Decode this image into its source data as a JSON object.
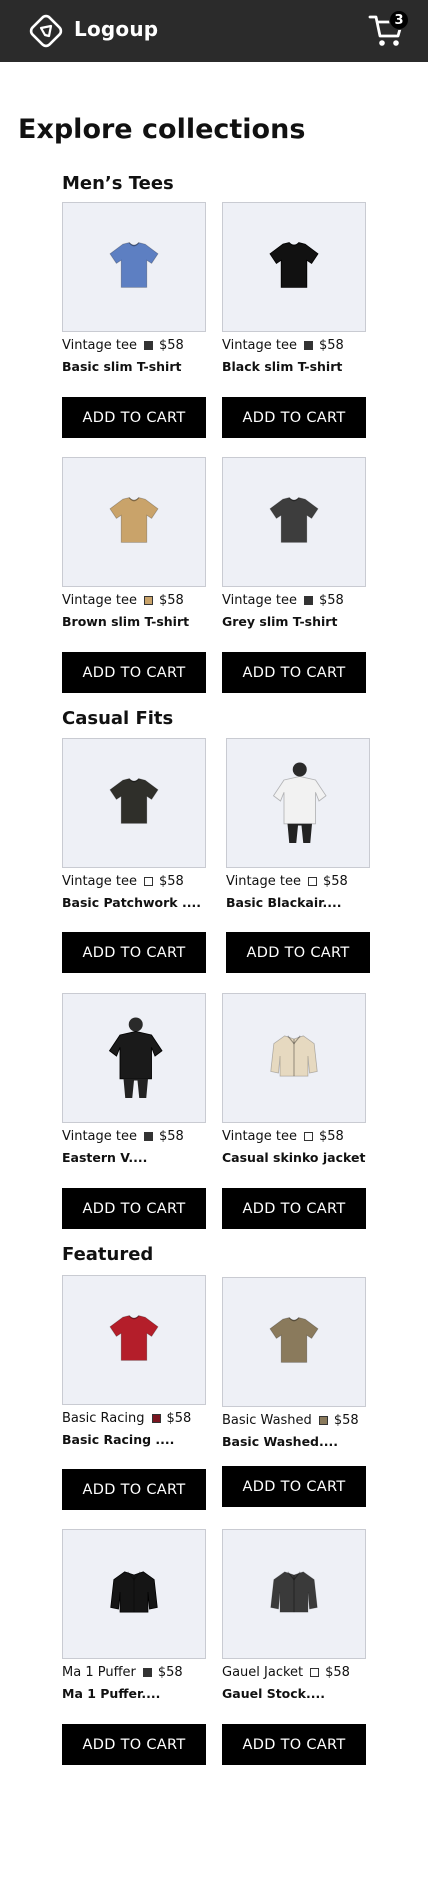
{
  "header": {
    "logo_text": "Logoup",
    "cart_count": "3",
    "colors": {
      "bar": "#2b2b2b",
      "text": "#ffffff"
    }
  },
  "page_title": "Explore collections",
  "add_label": "ADD TO CART",
  "sections": [
    {
      "title": "Men’s Tees",
      "products": [
        {
          "meta": "Vintage tee",
          "price": "$58",
          "name": "Basic slim T-shirt",
          "swatch": "#333333",
          "shirt": "#5d7fc2",
          "icon": "blue-tshirt-icon"
        },
        {
          "meta": "Vintage tee",
          "price": "$58",
          "name": "Black slim T-shirt",
          "swatch": "#333333",
          "shirt": "#111111",
          "icon": "black-tshirt-icon"
        },
        {
          "meta": "Vintage tee",
          "price": "$58",
          "name": "Brown slim T-shirt",
          "swatch": "#c9a36a",
          "shirt": "#c9a36a",
          "icon": "brown-tshirt-icon"
        },
        {
          "meta": "Vintage tee",
          "price": "$58",
          "name": "Grey slim T-shirt",
          "swatch": "#333333",
          "shirt": "#3d3d3d",
          "icon": "grey-tshirt-icon"
        }
      ]
    },
    {
      "title": "Casual Fits",
      "products": [
        {
          "meta": "Vintage tee",
          "price": "$58",
          "name": "Basic Patchwork ....",
          "swatch": "#ffffff",
          "shirt": "#2f2f2a",
          "icon": "patchwork-tshirt-icon"
        },
        {
          "meta": "Vintage tee",
          "price": "$58",
          "name": "Basic Blackair....",
          "swatch": "#ffffff",
          "shirt": "#f2f2f2",
          "icon": "white-tshirt-model-icon"
        },
        {
          "meta": "Vintage tee",
          "price": "$58",
          "name": "Eastern V....",
          "swatch": "#333333",
          "shirt": "#1a1a1a",
          "icon": "jersey-model-icon"
        },
        {
          "meta": "Vintage tee",
          "price": "$58",
          "name": "Casual skinko jacket",
          "swatch": "#ffffff",
          "shirt": "#e6d9c0",
          "icon": "jacket-icon"
        }
      ]
    },
    {
      "title": "Featured",
      "products": [
        {
          "meta": "Basic Racing",
          "price": "$58",
          "name": "Basic Racing ....",
          "swatch": "#7a1520",
          "shirt": "#b41e2a",
          "icon": "racing-tshirt-icon"
        },
        {
          "meta": "Basic Washed",
          "price": "$58",
          "name": "Basic Washed....",
          "swatch": "#8a7a5c",
          "shirt": "#8a7a5c",
          "icon": "washed-tshirt-icon"
        },
        {
          "meta": "Ma 1 Puffer",
          "price": "$58",
          "name": "Ma 1 Puffer....",
          "swatch": "#333333",
          "shirt": "#151515",
          "icon": "puffer-jacket-icon"
        },
        {
          "meta": "Gauel Jacket",
          "price": "$58",
          "name": "Gauel Stock....",
          "swatch": "#ffffff",
          "shirt": "#3a3a3a",
          "icon": "patch-jacket-icon"
        }
      ]
    }
  ]
}
